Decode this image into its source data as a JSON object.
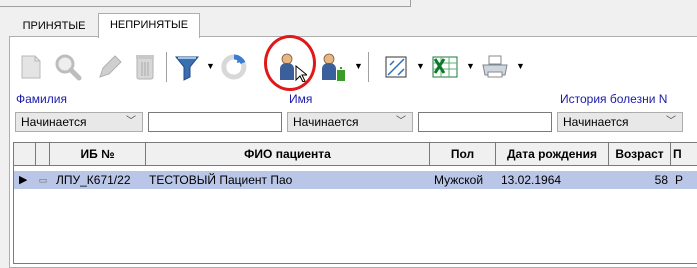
{
  "tabs": [
    {
      "label": "ПРИНЯТЫЕ",
      "active": false
    },
    {
      "label": "НЕПРИНЯТЫЕ",
      "active": true
    }
  ],
  "toolbar": {
    "icons": [
      "new-document-icon",
      "search-icon",
      "edit-pen-icon",
      "trash-icon",
      "filter-icon",
      "refresh-icon",
      "person-icon",
      "person-info-icon",
      "chart-icon",
      "excel-icon",
      "print-icon"
    ]
  },
  "filters": {
    "surname_label": "Фамилия",
    "name_label": "Имя",
    "history_label": "История болезни N",
    "surname_mode": "Начинается",
    "name_mode": "Начинается",
    "history_mode": "Начинается",
    "surname_value": "",
    "name_value": ""
  },
  "grid": {
    "columns": [
      "ИБ №",
      "ФИО пациента",
      "Пол",
      "Дата рождения",
      "Возраст",
      "П"
    ],
    "rows": [
      {
        "ib": "ЛПУ_К671/22",
        "fio": "ТЕСТОВЫЙ Пациент Пао",
        "sex": "Мужской",
        "dob": "13.02.1964",
        "age": "58",
        "p": "Р"
      }
    ]
  },
  "colors": {
    "accent_label": "#1a1aa8",
    "row_selected": "#b9c6e8",
    "highlight_ring": "#e01818"
  }
}
